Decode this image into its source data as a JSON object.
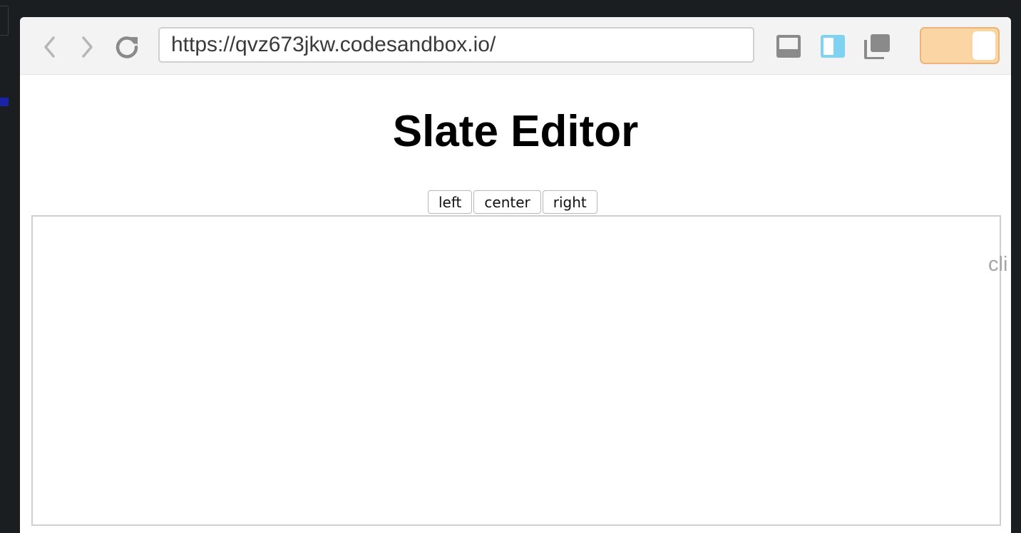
{
  "browser": {
    "url": "https://qvz673jkw.codesandbox.io/"
  },
  "page": {
    "title": "Slate Editor",
    "align_buttons": [
      "left",
      "center",
      "right"
    ],
    "clipped_hint": "cli"
  },
  "colors": {
    "toolbar_bg": "#f3f3f3",
    "icon_gray": "#8a8a8a",
    "icon_active_blue": "#7fd3f2",
    "toggle_bg": "#fbd6a4",
    "toggle_border": "#e9b57a",
    "outer_bg": "#1b1e21"
  },
  "icons": {
    "back": "chevron-left-icon",
    "forward": "chevron-right-icon",
    "reload": "reload-icon",
    "console": "console-panel-icon",
    "split": "split-view-icon",
    "windows": "new-window-icon"
  }
}
